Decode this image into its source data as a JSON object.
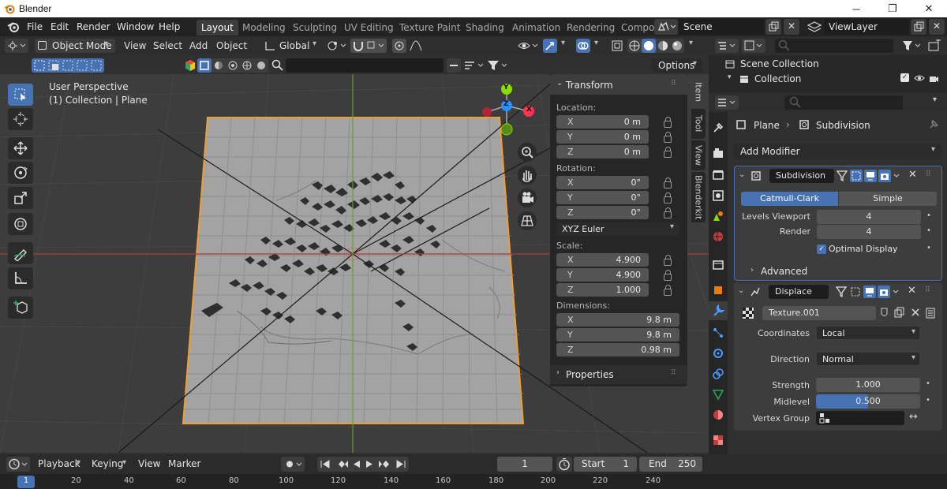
{
  "window": {
    "title": "Blender",
    "controls": [
      "─",
      "❐",
      "✕"
    ]
  },
  "menu": [
    "File",
    "Edit",
    "Render",
    "Window",
    "Help"
  ],
  "workspace_tabs": [
    "Layout",
    "Modeling",
    "Sculpting",
    "UV Editing",
    "Texture Paint",
    "Shading",
    "Animation",
    "Rendering",
    "Compo"
  ],
  "scene": {
    "name": "Scene",
    "view_layer": "ViewLayer"
  },
  "viewport_header": {
    "mode": "Object Mode",
    "menus": [
      "View",
      "Select",
      "Add",
      "Object"
    ],
    "orientation": "Global",
    "options_label": "Options"
  },
  "viewport": {
    "perspective": "User Perspective",
    "collection_info": "(1) Collection | Plane"
  },
  "gizmo": {
    "x": "X",
    "y": "Y",
    "z": "Z"
  },
  "n_panel": {
    "header": "Transform",
    "location_label": "Location:",
    "location": [
      {
        "axis": "X",
        "value": "0 m"
      },
      {
        "axis": "Y",
        "value": "0 m"
      },
      {
        "axis": "Z",
        "value": "0 m"
      }
    ],
    "rotation_label": "Rotation:",
    "rotation": [
      {
        "axis": "X",
        "value": "0°"
      },
      {
        "axis": "Y",
        "value": "0°"
      },
      {
        "axis": "Z",
        "value": "0°"
      }
    ],
    "rotation_mode": "XYZ Euler",
    "scale_label": "Scale:",
    "scale": [
      {
        "axis": "X",
        "value": "4.900"
      },
      {
        "axis": "Y",
        "value": "4.900"
      },
      {
        "axis": "Z",
        "value": "1.000"
      }
    ],
    "dimensions_label": "Dimensions:",
    "dimensions": [
      {
        "axis": "X",
        "value": "9.8 m"
      },
      {
        "axis": "Y",
        "value": "9.8 m"
      },
      {
        "axis": "Z",
        "value": "0.98 m"
      }
    ],
    "properties_label": "Properties",
    "side_tabs": [
      "Item",
      "Tool",
      "View",
      "Blenderkit"
    ]
  },
  "outliner": {
    "root": "Scene Collection",
    "collection": "Collection"
  },
  "properties": {
    "breadcrumb_object": "Plane",
    "breadcrumb_modifier": "Subdivision",
    "add_modifier": "Add Modifier",
    "subdivision": {
      "name": "Subdivision",
      "mode_catmull": "Catmull-Clark",
      "mode_simple": "Simple",
      "levels_viewport_label": "Levels Viewport",
      "levels_viewport": "4",
      "render_label": "Render",
      "render": "4",
      "optimal_display": "Optimal Display",
      "advanced": "Advanced"
    },
    "displace": {
      "name": "Displace",
      "texture": "Texture.001",
      "coordinates_label": "Coordinates",
      "coordinates": "Local",
      "direction_label": "Direction",
      "direction": "Normal",
      "strength_label": "Strength",
      "strength": "1.000",
      "midlevel_label": "Midlevel",
      "midlevel": "0.500",
      "midlevel_fraction": 0.5,
      "vertex_group_label": "Vertex Group"
    }
  },
  "timeline": {
    "menus": [
      "Playback",
      "Keying",
      "View",
      "Marker"
    ],
    "current_frame": "1",
    "start_label": "Start",
    "start": "1",
    "end_label": "End",
    "end": "250",
    "ruler": [
      "20",
      "40",
      "60",
      "80",
      "100",
      "120",
      "140",
      "160",
      "180",
      "200",
      "220",
      "240"
    ],
    "ruler_first": "1"
  },
  "colors": {
    "accent": "#4772b3",
    "selection_orange": "#f0a030",
    "x_axis": "#ff3352",
    "y_axis": "#8bdc00",
    "z_axis": "#2890ff"
  }
}
